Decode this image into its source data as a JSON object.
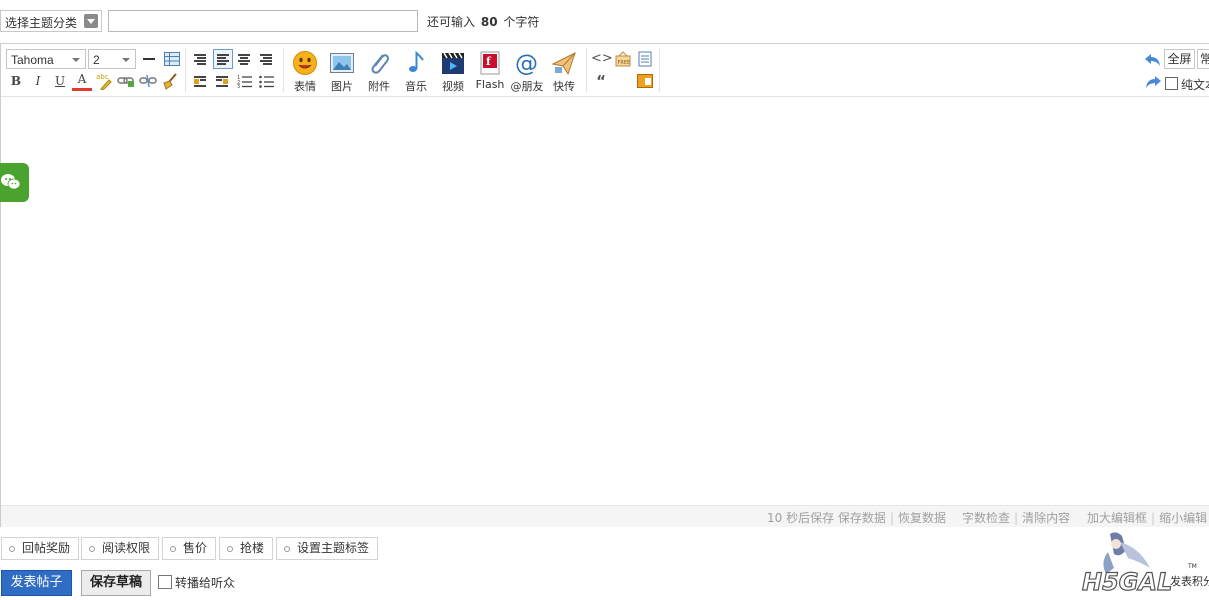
{
  "top": {
    "category_label": "选择主题分类",
    "title_value": "",
    "char_hint_prefix": "还可输入",
    "char_count": "80",
    "char_hint_suffix": "个字符"
  },
  "toolbar": {
    "font_family": "Tahoma",
    "font_size": "2",
    "bold": "B",
    "italic": "I",
    "underline": "U",
    "font_color": "A",
    "big_buttons": [
      {
        "label": "表情",
        "icon": "smiley-icon"
      },
      {
        "label": "图片",
        "icon": "image-icon"
      },
      {
        "label": "附件",
        "icon": "paperclip-icon"
      },
      {
        "label": "音乐",
        "icon": "music-note-icon"
      },
      {
        "label": "视频",
        "icon": "video-clapper-icon"
      },
      {
        "label": "Flash",
        "icon": "flash-icon"
      },
      {
        "label": "@朋友",
        "icon": "at-icon"
      },
      {
        "label": "快传",
        "icon": "paper-plane-icon"
      }
    ],
    "quote_symbol": "“",
    "fullscreen_label": "全屏",
    "common_label": "常",
    "plaintext_label": "纯文本"
  },
  "statusbar": {
    "autosave": "10 秒后保存",
    "save_data": "保存数据",
    "restore_data": "恢复数据",
    "word_check": "字数检查",
    "clear_content": "清除内容",
    "enlarge": "加大编辑框",
    "shrink": "缩小编辑"
  },
  "options": [
    "回帖奖励",
    "阅读权限",
    "售价",
    "抢楼",
    "设置主题标签"
  ],
  "actions": {
    "publish": "发表帖子",
    "save_draft": "保存草稿",
    "broadcast": "转播给听众"
  },
  "watermark": {
    "text": "发表积分",
    "tm": "TM"
  },
  "colors": {
    "publish_bg": "#2f6cc4",
    "wechat_green": "#4aa32e",
    "status_text": "#a0a0a0"
  }
}
